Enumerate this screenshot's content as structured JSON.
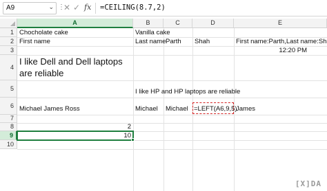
{
  "formula_bar": {
    "name_box": "A9",
    "cancel_symbol": "✕",
    "confirm_symbol": "✓",
    "fx_label": "fx",
    "formula": "=CEILING(8.7,2)"
  },
  "columns": [
    "A",
    "B",
    "C",
    "D",
    "E"
  ],
  "selected_column": "A",
  "rows": [
    "1",
    "2",
    "3",
    "4",
    "5",
    "6",
    "7",
    "8",
    "9",
    "10"
  ],
  "selected_row": "9",
  "cells": {
    "A1": "Chocholate cake",
    "B1": "Vanilla cake",
    "A2": "First name",
    "B2": "Last name",
    "C2": "Parth",
    "D2": "Shah",
    "E2": "First name:Parth,Last name:Shah",
    "E3": "12:20 PM",
    "A4": "I like Dell and Dell laptops are reliable",
    "B5": "I like HP and HP laptops are reliable",
    "A6": "Michael James Ross",
    "B6": "Michael",
    "C6": "Michael",
    "D6": "=LEFT(A6,9,5)",
    "E6": "James",
    "A8": "2",
    "A9": "10"
  },
  "watermark": "XDA",
  "colors": {
    "accent_green": "#1e7e3e",
    "copy_marquee_red": "#d32020"
  }
}
